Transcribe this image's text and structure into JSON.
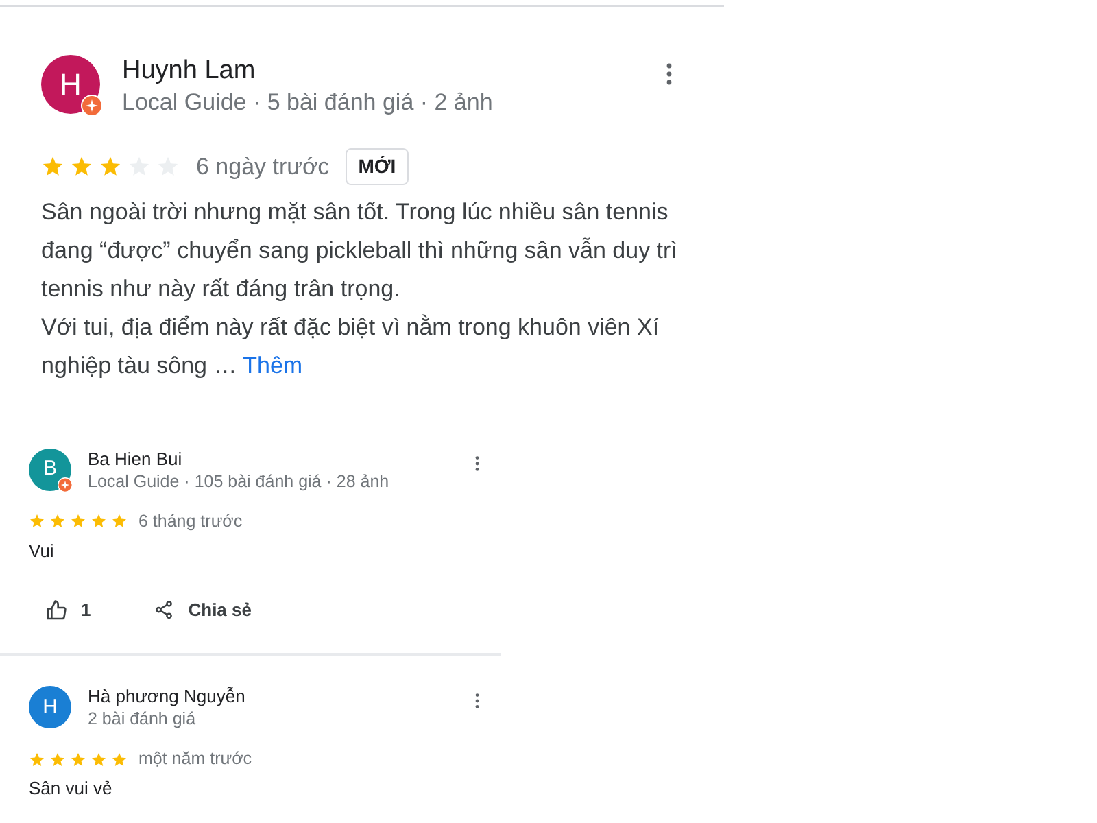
{
  "reviews": [
    {
      "kind": "large",
      "initial": "H",
      "color": "#c2185b",
      "local_guide": true,
      "name": "Huynh Lam",
      "meta": "Local Guide · 5 bài đánh giá · 2 ảnh",
      "stars": 3,
      "time": "6 ngày trước",
      "badge": "MỚI",
      "paragraphs": [
        "Sân ngoài trời nhưng mặt sân tốt. Trong lúc nhiều sân tennis đang “được” chuyển sang pickleball thì những sân vẫn duy trì tennis như này rất đáng trân trọng.",
        "Với tui, địa điểm này rất đặc biệt vì nằm trong khuôn viên Xí nghiệp tàu sông …"
      ],
      "more": "Thêm"
    },
    {
      "kind": "compact",
      "initial": "B",
      "color": "#13959a",
      "local_guide": true,
      "name": "Ba Hien Bui",
      "meta": "Local Guide · 105 bài đánh giá · 28 ảnh",
      "stars": 5,
      "time": "6 tháng trước",
      "paragraphs": [
        "Vui"
      ],
      "likes": "1",
      "share": "Chia sẻ"
    },
    {
      "kind": "compact",
      "initial": "H",
      "color": "#1a7fd4",
      "local_guide": false,
      "name": "Hà phương Nguyễn",
      "meta": "2 bài đánh giá",
      "stars": 5,
      "time": "một năm trước",
      "paragraphs": [
        "Sân vui vẻ"
      ]
    }
  ]
}
